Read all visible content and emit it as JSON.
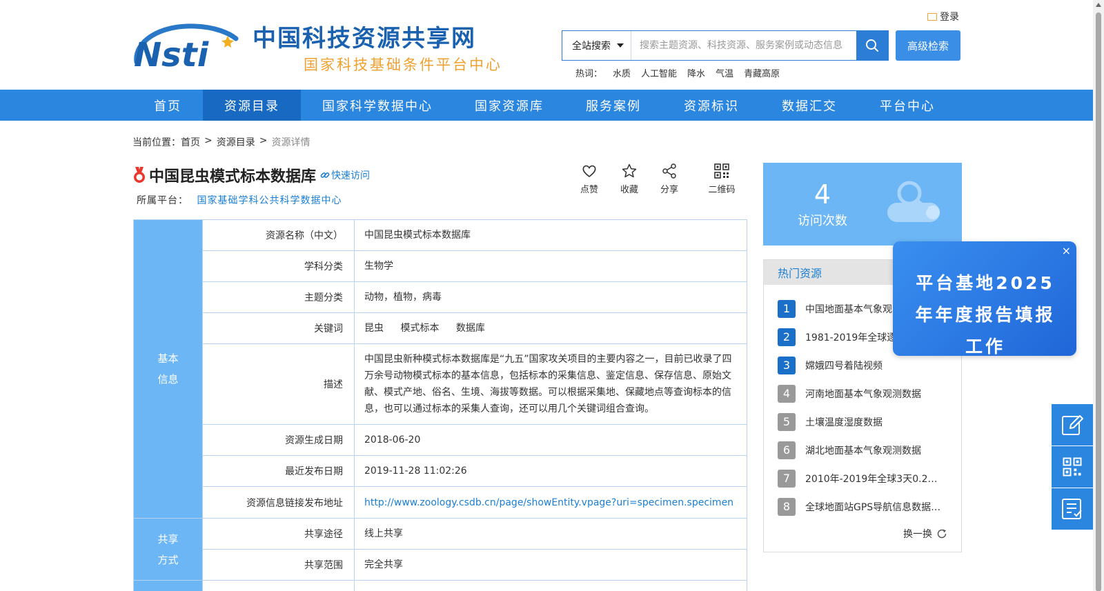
{
  "header": {
    "site_title": "中国科技资源共享网",
    "site_subtitle": "国家科技基础条件平台中心",
    "login_label": "登录",
    "search_scope": "全站搜索",
    "search_placeholder": "搜索主题资源、科技资源、服务案例或动态信息",
    "advanced_search": "高级检索",
    "hot_label": "热词：",
    "hot_words": [
      "水质",
      "人工智能",
      "降水",
      "气温",
      "青藏高原"
    ]
  },
  "nav": {
    "items": [
      "首页",
      "资源目录",
      "国家科学数据中心",
      "国家资源库",
      "服务案例",
      "资源标识",
      "数据汇交",
      "平台中心"
    ],
    "active": "资源目录"
  },
  "breadcrumb": {
    "prefix": "当前位置：",
    "items": [
      "首页",
      "资源目录",
      "资源详情"
    ]
  },
  "resource": {
    "title": "中国昆虫模式标本数据库",
    "quick_access": "快速访问",
    "platform_label": "所属平台：",
    "platform_value": "国家基础学科公共科学数据中心"
  },
  "actions": {
    "like": "点赞",
    "favorite": "收藏",
    "share": "分享",
    "qrcode": "二维码"
  },
  "table": {
    "basic_category": [
      "基本",
      "信息"
    ],
    "share_category": [
      "共享",
      "方式"
    ],
    "rows": [
      {
        "label": "资源名称（中文）",
        "value": "中国昆虫模式标本数据库"
      },
      {
        "label": "学科分类",
        "value": "生物学"
      },
      {
        "label": "主题分类",
        "value": "动物，植物，病毒"
      },
      {
        "label": "关键词",
        "keywords": [
          "昆虫",
          "模式标本",
          "数据库"
        ]
      },
      {
        "label": "描述",
        "value": "中国昆虫新种模式标本数据库是“九五”国家攻关项目的主要内容之一，目前已收录了四万余号动物模式标本的基本信息，包括标本的采集信息、鉴定信息、保存信息、原始文献、模式产地、俗名、生境、海拔等数据。可以根据采集地、保藏地点等查询标本的信息，也可以通过标本的采集人查询，还可以用几个关键词组合查询。"
      },
      {
        "label": "资源生成日期",
        "value": "2018-06-20"
      },
      {
        "label": "最近发布日期",
        "value": "2019-11-28 11:02:26"
      },
      {
        "label": "资源信息链接发布地址",
        "value": "http://www.zoology.csdb.cn/page/showEntity.vpage?uri=specimen.specimen"
      },
      {
        "label": "共享途径",
        "value": "线上共享"
      },
      {
        "label": "共享范围",
        "value": "完全共享"
      }
    ]
  },
  "visits": {
    "count": "4",
    "label": "访问次数"
  },
  "hot_resources": {
    "title": "热门资源",
    "items": [
      {
        "rank": "1",
        "text": "中国地面基本气象观"
      },
      {
        "rank": "2",
        "text": "1981-2019年全球逐"
      },
      {
        "rank": "3",
        "text": "嫦娥四号着陆视频"
      },
      {
        "rank": "4",
        "text": "河南地面基本气象观测数据"
      },
      {
        "rank": "5",
        "text": "土壤温度湿度数据"
      },
      {
        "rank": "6",
        "text": "湖北地面基本气象观测数据"
      },
      {
        "rank": "7",
        "text": "2010年-2019年全球3天0.25°…"
      },
      {
        "rank": "8",
        "text": "全球地面站GPS导航信息数据…"
      }
    ],
    "refresh": "换一换"
  },
  "popup": {
    "text": "平台基地2025年年度报告填报工作",
    "close": "×"
  },
  "colors": {
    "nav_bg": "#2b86df",
    "nav_active": "#1769c2",
    "accent_blue": "#1a7fd4",
    "category_bg": "#6cb6f6",
    "subtitle_orange": "#f0a030"
  }
}
